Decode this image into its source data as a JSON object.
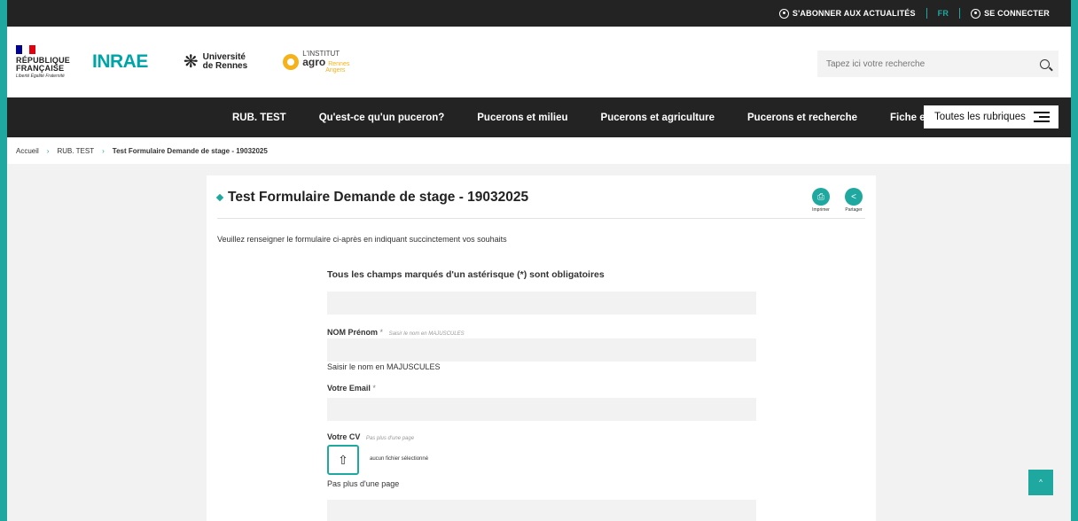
{
  "topbar": {
    "subscribe": "S'ABONNER AUX ACTUALITÉS",
    "lang": "FR",
    "login": "SE CONNECTER"
  },
  "header": {
    "republique_line1": "RÉPUBLIQUE",
    "republique_line2": "FRANÇAISE",
    "republique_motto": "Liberté Égalité Fraternité",
    "inrae": "INRAE",
    "universite_line1": "Université",
    "universite_line2": "de Rennes",
    "agro_small": "L'INSTITUT",
    "agro_big": "agro",
    "agro_city1": "Rennes",
    "agro_city2": "Angers",
    "search_placeholder": "Tapez ici votre recherche"
  },
  "nav": {
    "items": [
      "RUB. TEST",
      "Qu'est-ce qu'un puceron?",
      "Pucerons et milieu",
      "Pucerons et agriculture",
      "Pucerons et recherche",
      "Fiche espèces"
    ],
    "all_label": "Toutes les rubriques"
  },
  "breadcrumb": {
    "home": "Accueil",
    "section": "RUB. TEST",
    "current": "Test Formulaire Demande de stage - 19032025"
  },
  "page": {
    "title": "Test Formulaire Demande de stage - 19032025",
    "print_label": "Imprimer",
    "share_label": "Partager",
    "intro": "Veuillez renseigner le formulaire ci-après en indiquant succinctement vos souhaits"
  },
  "form": {
    "required_note": "Tous les champs marqués d'un astérisque (*) sont obligatoires",
    "name_label": "NOM Prénom",
    "name_hint": "Saisir le nom en MAJUSCULES",
    "name_help": "Saisir le nom en MAJUSCULES",
    "email_label": "Votre Email",
    "cv_label": "Votre CV",
    "cv_hint": "Pas plus d'une page",
    "no_file": "aucun fichier sélectionné",
    "cv_help": "Pas plus d'une page",
    "asterisk": "*"
  },
  "colors": {
    "accent": "#1fa8a0",
    "dark": "#232323"
  }
}
